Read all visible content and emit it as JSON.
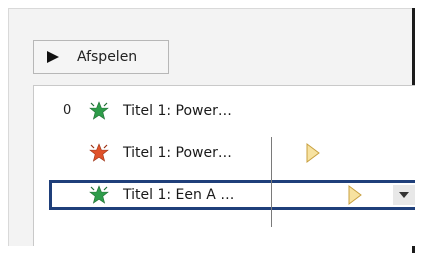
{
  "toolbar": {
    "play_label": "Afspelen"
  },
  "animations": [
    {
      "order": "0",
      "label": "Titel 1: Power…",
      "effect_icon": "entrance-star-icon",
      "color": "#2e9c4a"
    },
    {
      "order": "",
      "label": "Titel 1: Power…",
      "effect_icon": "emphasis-star-icon",
      "color": "#e0522a"
    },
    {
      "order": "",
      "label": "Titel 1: Een A …",
      "effect_icon": "entrance-star-icon",
      "color": "#2e9c4a",
      "selected": true
    }
  ],
  "colors": {
    "selection_border": "#1f3f7a",
    "timing_marker": "#f7e2a0"
  }
}
